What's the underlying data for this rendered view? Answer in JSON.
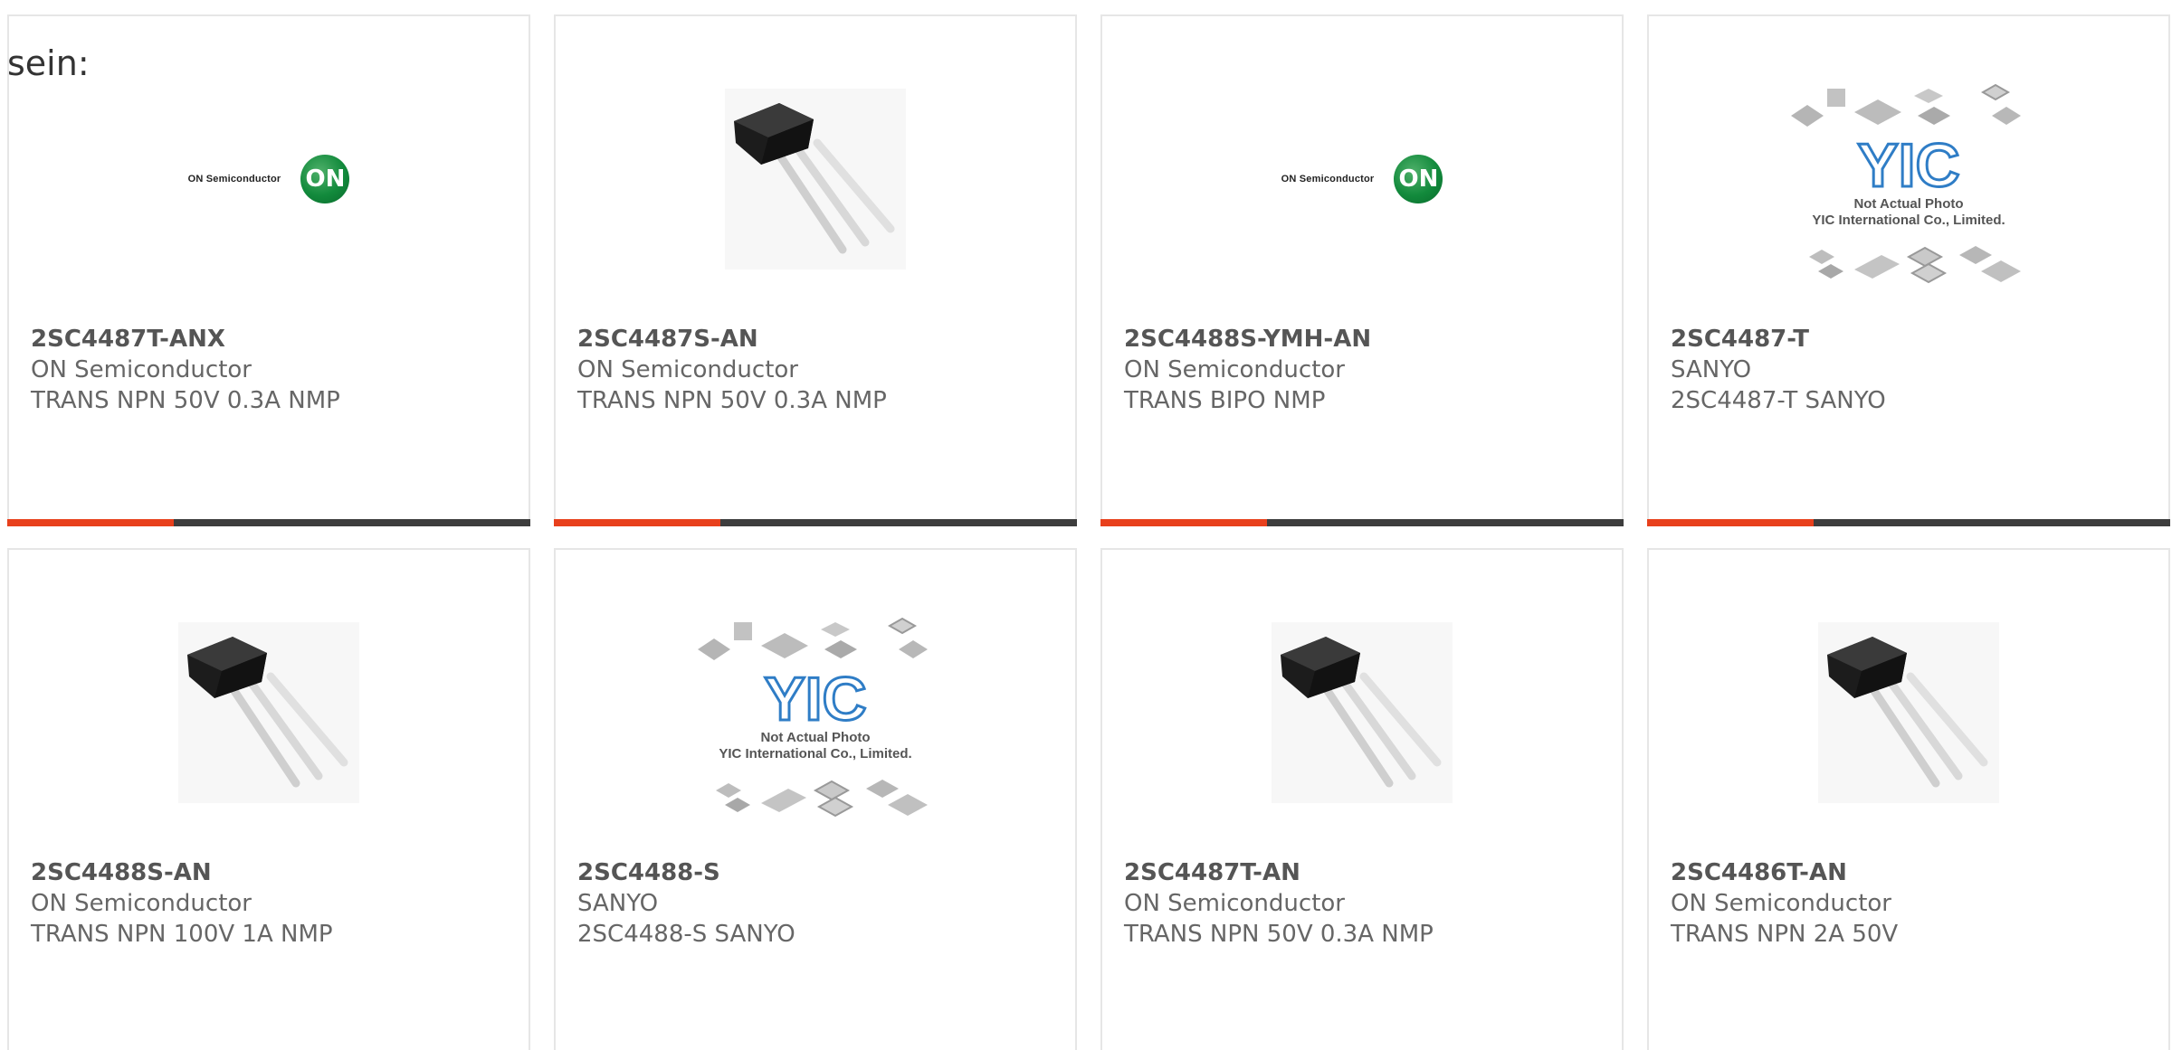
{
  "heading": "sein:",
  "colors": {
    "accent": "#e8401c",
    "bar": "#3d3d3d",
    "border": "#e6e6e6",
    "on_logo_green": "#128a3c"
  },
  "products": [
    {
      "part_number": "2SC4487T-ANX",
      "manufacturer": "ON Semiconductor",
      "description": "TRANS NPN 50V 0.3A NMP",
      "image": "on-semiconductor-logo",
      "logo_text": "ON Semiconductor",
      "logo_mark": "ON"
    },
    {
      "part_number": "2SC4487S-AN",
      "manufacturer": "ON Semiconductor",
      "description": "TRANS NPN 50V 0.3A NMP",
      "image": "transistor-photo"
    },
    {
      "part_number": "2SC4488S-YMH-AN",
      "manufacturer": "ON Semiconductor",
      "description": "TRANS BIPO NMP",
      "image": "on-semiconductor-logo",
      "logo_text": "ON Semiconductor",
      "logo_mark": "ON"
    },
    {
      "part_number": "2SC4487-T",
      "manufacturer": "SANYO",
      "description": "2SC4487-T SANYO",
      "image": "yic-placeholder",
      "placeholder_line1": "Not Actual Photo",
      "placeholder_line2": "YIC International Co., Limited."
    },
    {
      "part_number": "2SC4488S-AN",
      "manufacturer": "ON Semiconductor",
      "description": "TRANS NPN 100V 1A NMP",
      "image": "transistor-photo"
    },
    {
      "part_number": "2SC4488-S",
      "manufacturer": "SANYO",
      "description": "2SC4488-S SANYO",
      "image": "yic-placeholder",
      "placeholder_line1": "Not Actual Photo",
      "placeholder_line2": "YIC International Co., Limited."
    },
    {
      "part_number": "2SC4487T-AN",
      "manufacturer": "ON Semiconductor",
      "description": "TRANS NPN 50V 0.3A NMP",
      "image": "transistor-photo"
    },
    {
      "part_number": "2SC4486T-AN",
      "manufacturer": "ON Semiconductor",
      "description": "TRANS NPN 2A 50V",
      "image": "transistor-photo"
    }
  ]
}
